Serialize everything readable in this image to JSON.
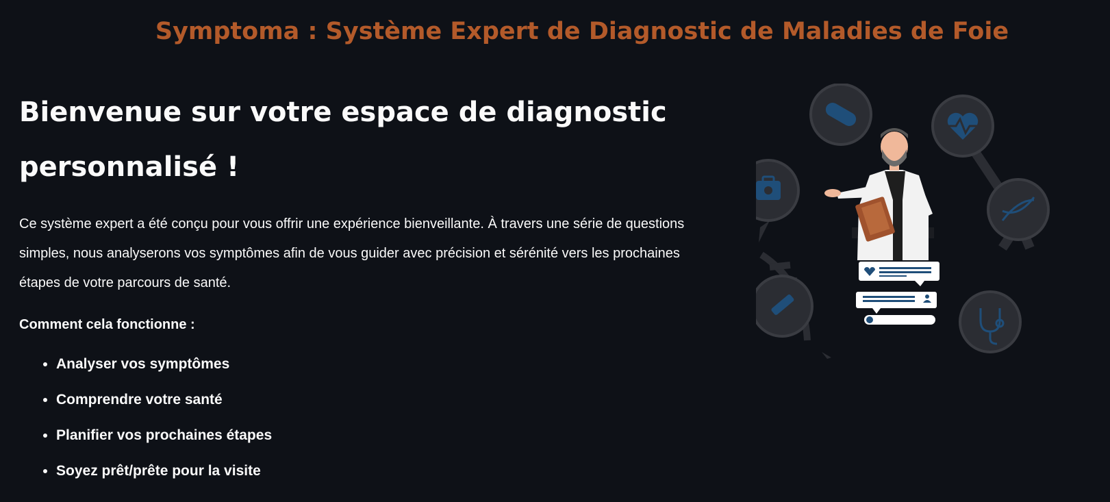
{
  "header": {
    "title": "Symptoma : Système Expert de Diagnostic de Maladies de Foie"
  },
  "main": {
    "heading": "Bienvenue sur votre espace de diagnostic personnalisé !",
    "intro": "Ce système expert a été conçu pour vous offrir une expérience bienveillante. À travers une série de questions simples, nous analyserons vos symptômes afin de vous guider avec précision et sérénité vers les prochaines étapes de votre parcours de santé.",
    "how_label": "Comment cela fonctionne :",
    "steps": [
      "Analyser vos symptômes",
      "Comprendre votre santé",
      "Planifier vos prochaines étapes",
      "Soyez prêt/prête pour la visite"
    ]
  },
  "illustration": {
    "icons": [
      "pill-icon",
      "heart-rate-icon",
      "medical-kit-icon",
      "dna-icon",
      "syringe-icon",
      "stethoscope-icon"
    ],
    "colors": {
      "circle": "#2b2d33",
      "circle_ring": "#3a3c42",
      "icon_blue": "#1f4e79",
      "coat": "#f2f2f2",
      "clipboard": "#a0522d",
      "skin": "#f0b89a",
      "beard": "#6b6b6b"
    }
  }
}
